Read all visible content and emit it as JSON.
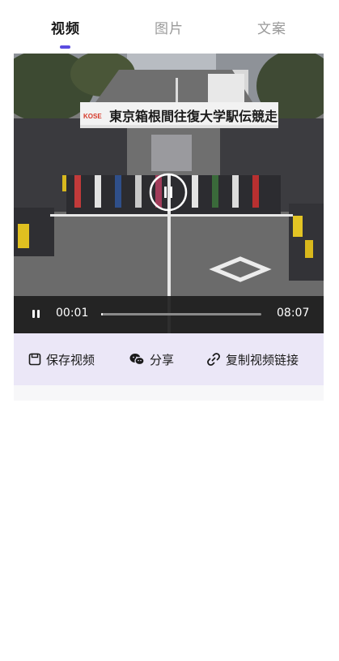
{
  "tabs": [
    {
      "label": "视频",
      "active": true
    },
    {
      "label": "图片",
      "active": false
    },
    {
      "label": "文案",
      "active": false
    }
  ],
  "video": {
    "banner_text": "東京箱根間往復大学駅伝競走",
    "sponsor_text": "KOSE",
    "current_time": "00:01",
    "duration": "08:07",
    "progress": 0.002
  },
  "actions": [
    {
      "label": "保存视频",
      "icon": "save-icon"
    },
    {
      "label": "分享",
      "icon": "wechat-icon"
    },
    {
      "label": "复制视频链接",
      "icon": "link-icon"
    }
  ],
  "colors": {
    "accent": "#5b4ce0",
    "action_bar_bg": "#ebe7f7"
  }
}
